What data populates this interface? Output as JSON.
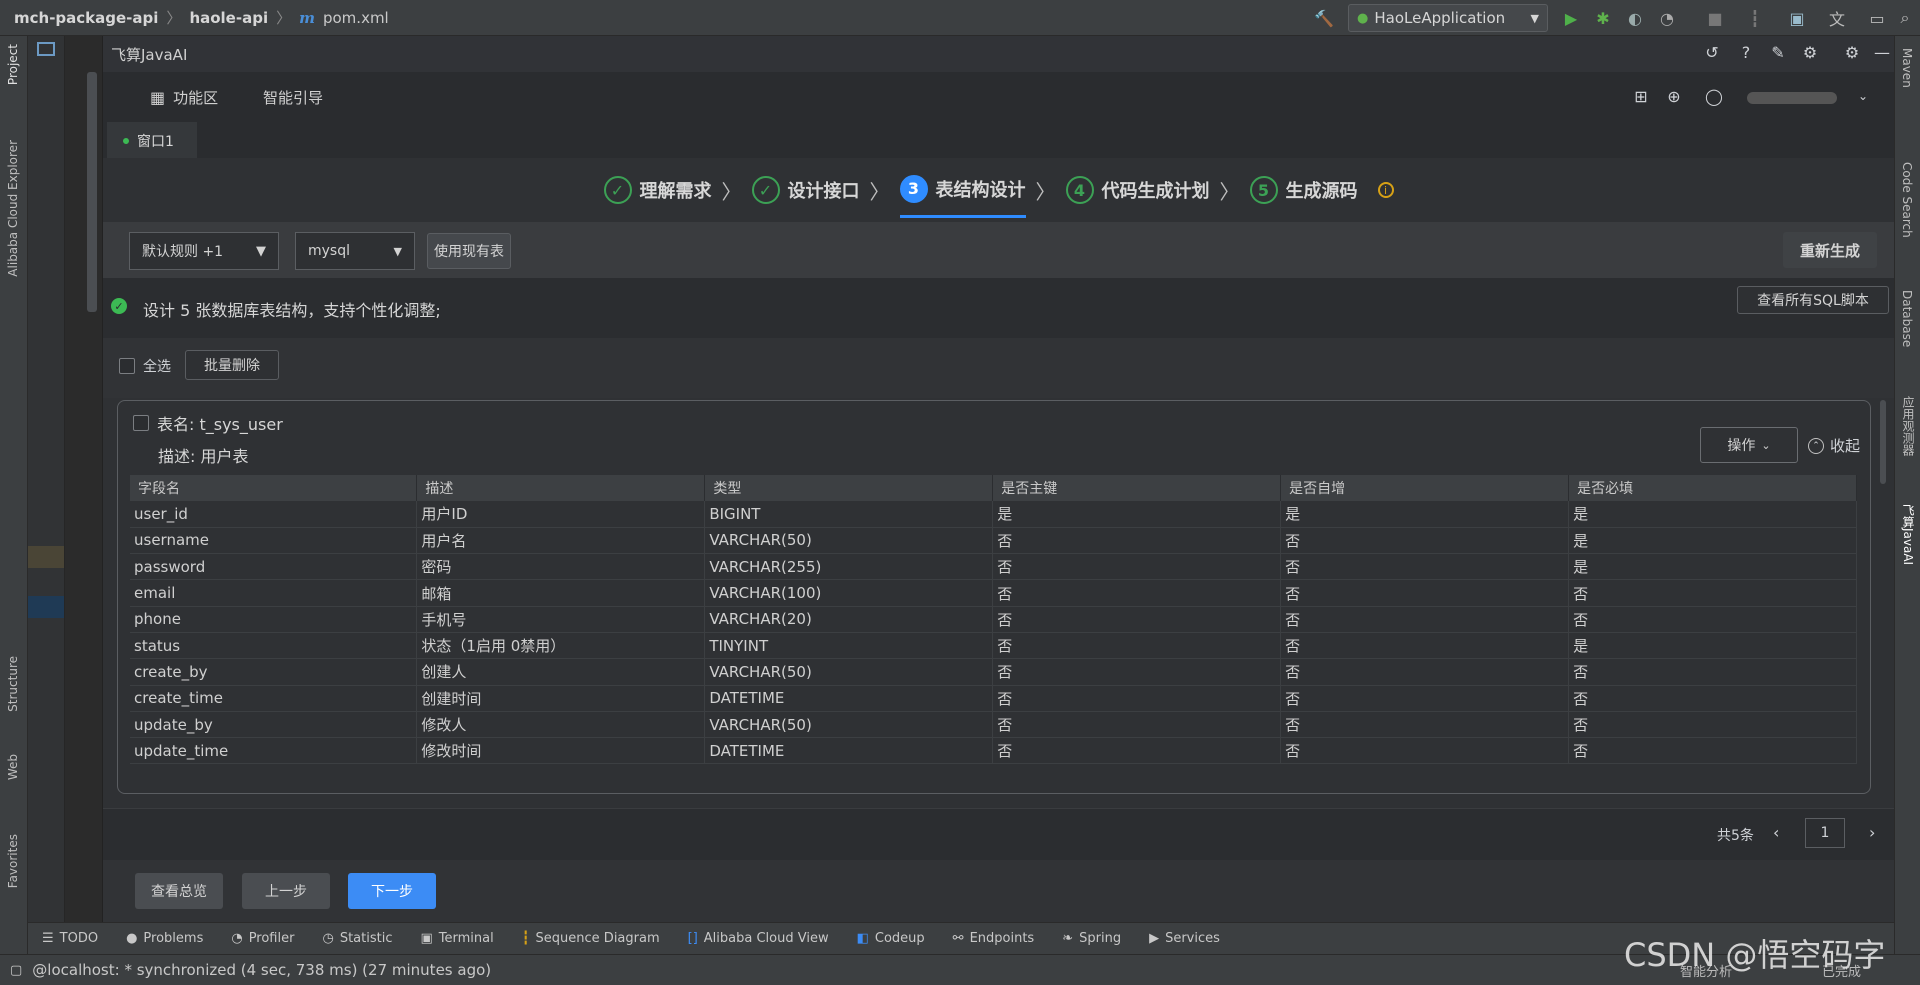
{
  "topbar": {
    "breadcrumb": [
      "mch-package-api",
      "haole-api",
      "pom.xml"
    ],
    "run_config": "HaoLeApplication"
  },
  "left_strip": {
    "project": "Project",
    "cloud": "Alibaba Cloud Explorer",
    "structure": "Structure",
    "web": "Web",
    "favorites": "Favorites"
  },
  "right_strip": {
    "maven": "Maven",
    "code_search": "Code Search",
    "database": "Database",
    "app_observe": "应用观测器",
    "feisuan": "飞算JavaAI"
  },
  "panel": {
    "title": "飞算JavaAI",
    "func_area": "功能区",
    "smart_guide": "智能引导",
    "window_tab": "窗口1"
  },
  "steps": [
    {
      "label": "理解需求",
      "state": "done",
      "num": "✓"
    },
    {
      "label": "设计接口",
      "state": "done",
      "num": "✓"
    },
    {
      "label": "表结构设计",
      "state": "active",
      "num": "3"
    },
    {
      "label": "代码生成计划",
      "state": "todo",
      "num": "4"
    },
    {
      "label": "生成源码",
      "state": "todo",
      "num": "5"
    }
  ],
  "toolbar": {
    "rule_select": "默认规则 +1",
    "db_select": "mysql",
    "use_existing": "使用现有表",
    "regenerate": "重新生成"
  },
  "info": {
    "message": "设计 5 张数据库表结构，支持个性化调整;",
    "view_sql": "查看所有SQL脚本"
  },
  "select_bar": {
    "select_all": "全选",
    "batch_delete": "批量删除"
  },
  "card": {
    "table_name": "表名: t_sys_user",
    "description": "描述: 用户表",
    "actions": "操作",
    "collapse": "收起",
    "columns": [
      "字段名",
      "描述",
      "类型",
      "是否主键",
      "是否自增",
      "是否必填"
    ],
    "rows": [
      [
        "user_id",
        "用户ID",
        "BIGINT",
        "是",
        "是",
        "是"
      ],
      [
        "username",
        "用户名",
        "VARCHAR(50)",
        "否",
        "否",
        "是"
      ],
      [
        "password",
        "密码",
        "VARCHAR(255)",
        "否",
        "否",
        "是"
      ],
      [
        "email",
        "邮箱",
        "VARCHAR(100)",
        "否",
        "否",
        "否"
      ],
      [
        "phone",
        "手机号",
        "VARCHAR(20)",
        "否",
        "否",
        "否"
      ],
      [
        "status",
        "状态（1启用 0禁用）",
        "TINYINT",
        "否",
        "否",
        "是"
      ],
      [
        "create_by",
        "创建人",
        "VARCHAR(50)",
        "否",
        "否",
        "否"
      ],
      [
        "create_time",
        "创建时间",
        "DATETIME",
        "否",
        "否",
        "否"
      ],
      [
        "update_by",
        "修改人",
        "VARCHAR(50)",
        "否",
        "否",
        "否"
      ],
      [
        "update_time",
        "修改时间",
        "DATETIME",
        "否",
        "否",
        "否"
      ]
    ]
  },
  "pager": {
    "total": "共5条",
    "page": "1"
  },
  "bottom_actions": {
    "overview": "查看总览",
    "prev": "上一步",
    "next": "下一步"
  },
  "tool_windows": [
    "TODO",
    "Problems",
    "Profiler",
    "Statistic",
    "Terminal",
    "Sequence Diagram",
    "Alibaba Cloud View",
    "Codeup",
    "Endpoints",
    "Spring",
    "Services"
  ],
  "status": {
    "text": "@localhost: * synchronized (4 sec, 738 ms) (27 minutes ago)",
    "right1": "智能分析",
    "right2": "已完成",
    "watermark": "CSDN @悟空码字"
  }
}
